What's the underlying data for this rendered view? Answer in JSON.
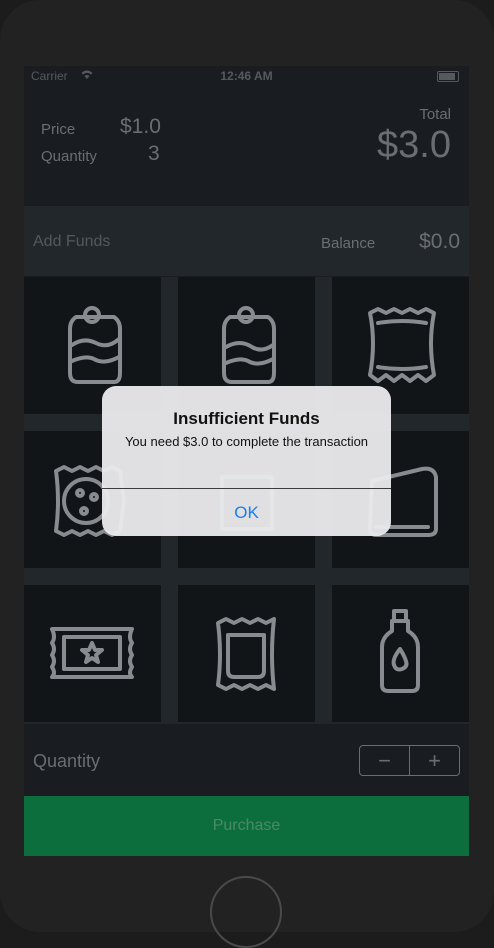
{
  "status_bar": {
    "carrier": "Carrier",
    "time": "12:46 AM"
  },
  "summary": {
    "price_label": "Price",
    "price_value": "$1.0",
    "quantity_label": "Quantity",
    "quantity_value": "3",
    "total_label": "Total",
    "total_value": "$3.0"
  },
  "funds": {
    "add_funds_label": "Add Funds",
    "balance_label": "Balance",
    "balance_value": "$0.0"
  },
  "products": [
    {
      "icon": "soda-can-icon"
    },
    {
      "icon": "soda-can-icon"
    },
    {
      "icon": "chips-bag-icon"
    },
    {
      "icon": "cookie-pack-icon"
    },
    {
      "icon": "snack-icon"
    },
    {
      "icon": "wafer-pack-icon"
    },
    {
      "icon": "candy-bar-icon"
    },
    {
      "icon": "snack-bag-icon"
    },
    {
      "icon": "water-bottle-icon"
    }
  ],
  "quantity_row": {
    "label": "Quantity",
    "minus": "−",
    "plus": "+"
  },
  "purchase_button": {
    "label": "Purchase",
    "color": "#0e7340"
  },
  "alert": {
    "title": "Insufficient Funds",
    "message": "You need $3.0 to complete the transaction",
    "ok_label": "OK",
    "ok_color": "#1a7ef0"
  }
}
